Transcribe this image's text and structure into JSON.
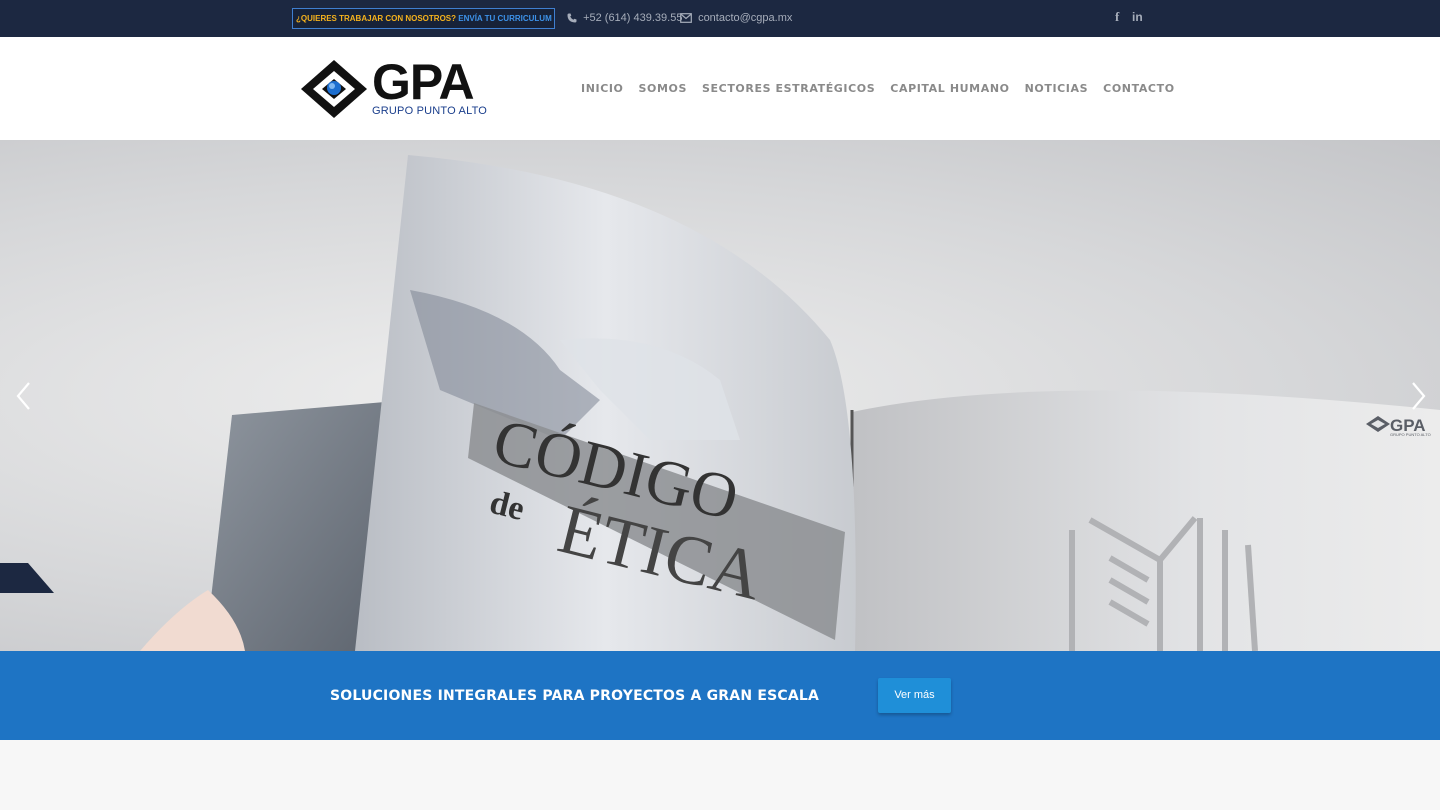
{
  "topbar": {
    "careers_question": "¿QUIERES TRABAJAR CON NOSOTROS?",
    "careers_link": "ENVÍA TU CURRICULUM AQUÍ",
    "phone": "+52 (614) 439.39.55",
    "email": "contacto@cgpa.mx",
    "social": {
      "facebook": "f",
      "linkedin": "in"
    }
  },
  "header": {
    "logo_text": "GPA",
    "logo_subtitle": "GRUPO PUNTO ALTO",
    "nav": [
      {
        "label": "INICIO"
      },
      {
        "label": "SOMOS"
      },
      {
        "label": "SECTORES ESTRATÉGICOS"
      },
      {
        "label": "CAPITAL HUMANO"
      },
      {
        "label": "NOTICIAS"
      },
      {
        "label": "CONTACTO"
      }
    ]
  },
  "hero": {
    "slide_title_1": "CÓDIGO",
    "slide_title_2": "de",
    "slide_title_3": "ÉTICA",
    "watermark_logo": "GPA",
    "watermark_sub": "GRUPO PUNTO ALTO",
    "icons": {
      "prev": "chevron-left-icon",
      "next": "chevron-right-icon"
    }
  },
  "cta": {
    "text": "SOLUCIONES INTEGRALES PARA PROYECTOS A GRAN ESCALA",
    "button": "Ver más"
  },
  "colors": {
    "topbar_bg": "#1c2841",
    "accent_blue": "#1e74c4",
    "careers_yellow": "#f5b21d",
    "nav_gray": "#8a8a8a"
  }
}
